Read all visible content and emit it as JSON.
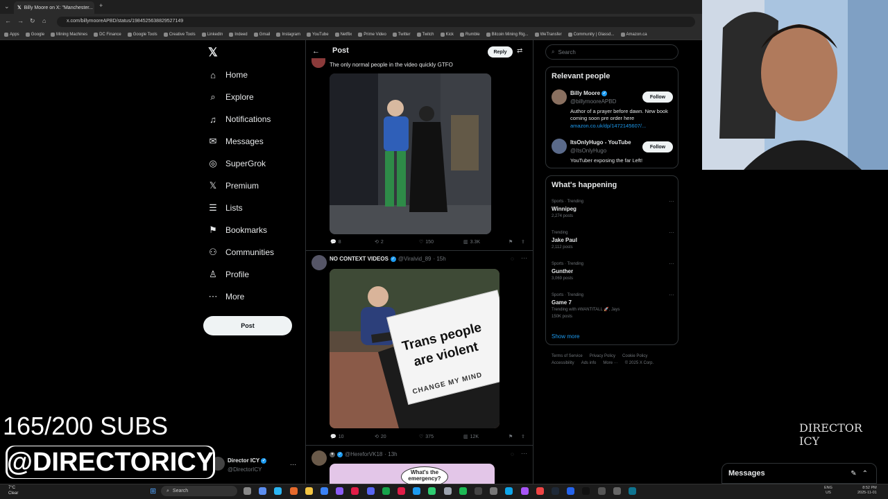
{
  "browser": {
    "tab_title": "Billy Moore on X: \"Manchester...",
    "url": "x.com/billymooreAPBD/status/1984525638829527149",
    "bookmarks": [
      "Apps",
      "Google",
      "Mining Machines",
      "DC Finance",
      "Google Tools",
      "Creative Tools",
      "LinkedIn",
      "Indeed",
      "Gmail",
      "Instagram",
      "YouTube",
      "Netflix",
      "Prime Video",
      "Twitter",
      "Twitch",
      "Kick",
      "Rumble",
      "Bitcoin Mining Rig...",
      "WeTransfer",
      "Community | Glassd...",
      "Amazon.ca"
    ]
  },
  "nav": {
    "items": [
      {
        "label": "Home",
        "icon": "⌂"
      },
      {
        "label": "Explore",
        "icon": "⌕"
      },
      {
        "label": "Notifications",
        "icon": "♫"
      },
      {
        "label": "Messages",
        "icon": "✉"
      },
      {
        "label": "SuperGrok",
        "icon": "◎"
      },
      {
        "label": "Premium",
        "icon": "𝕏"
      },
      {
        "label": "Lists",
        "icon": "☰"
      },
      {
        "label": "Bookmarks",
        "icon": "⚑"
      },
      {
        "label": "Communities",
        "icon": "⚇"
      },
      {
        "label": "Profile",
        "icon": "♙"
      },
      {
        "label": "More",
        "icon": "⋯"
      }
    ],
    "post_label": "Post",
    "account_name": "Director ICY",
    "account_handle": "@DirectorICY"
  },
  "main": {
    "header_title": "Post",
    "reply_label": "Reply",
    "post1": {
      "text": "The only normal people in the video quickly GTFO",
      "replies": "8",
      "reposts": "2",
      "likes": "150",
      "views": "3.3K"
    },
    "post2": {
      "author": "NO CONTEXT VIDEOS",
      "handle": "@Viralvid_89",
      "time": "· 15h",
      "sign_line1": "Trans people",
      "sign_line2": "are violent",
      "sign_line3": "CHANGE MY MIND",
      "replies": "10",
      "reposts": "20",
      "likes": "375",
      "views": "12K"
    },
    "post3": {
      "handle": "@HereforVK18",
      "time": "· 13h",
      "bubble": "What's the emergency?"
    }
  },
  "right": {
    "search_placeholder": "Search",
    "relevant_title": "Relevant people",
    "people": [
      {
        "name": "Billy Moore",
        "handle": "@billymooreAPBD",
        "bio": "Author of a prayer before dawn. New book coming soon pre order here",
        "link": "amazon.co.uk/dp/1472145607/...",
        "follow": "Follow"
      },
      {
        "name": "ItsOnlyHugo - YouTube",
        "handle": "@ItsOnlyHugo",
        "bio": "YouTuber exposing the far Left!",
        "link": "",
        "follow": "Follow"
      }
    ],
    "happening_title": "What's happening",
    "trends": [
      {
        "cat": "Sports · Trending",
        "name": "Winnipeg",
        "count": "2,274 posts",
        "extra": ""
      },
      {
        "cat": "Trending",
        "name": "Jake Paul",
        "count": "2,112 posts",
        "extra": ""
      },
      {
        "cat": "Sports · Trending",
        "name": "Gunther",
        "count": "3,069 posts",
        "extra": ""
      },
      {
        "cat": "Sports · Trending",
        "name": "Game 7",
        "count": "150K posts",
        "extra": "Trending with #WANTITALL 🚀, Jays"
      }
    ],
    "show_more": "Show more",
    "footer": [
      "Terms of Service",
      "Privacy Policy",
      "Cookie Policy",
      "Accessibility",
      "Ads info",
      "More ···",
      "© 2025 X Corp."
    ]
  },
  "overlay": {
    "subs": "165/200 SUBS",
    "handle": "@DIRECTORICY",
    "logo_text": "DIRECTOR ICY"
  },
  "messages_drawer": "Messages",
  "taskbar": {
    "weather_temp": "7°C",
    "weather_desc": "Clear",
    "search": "Search",
    "lang": "ENG",
    "region": "US",
    "time": "8:52 PM",
    "date": "2025-11-01"
  }
}
